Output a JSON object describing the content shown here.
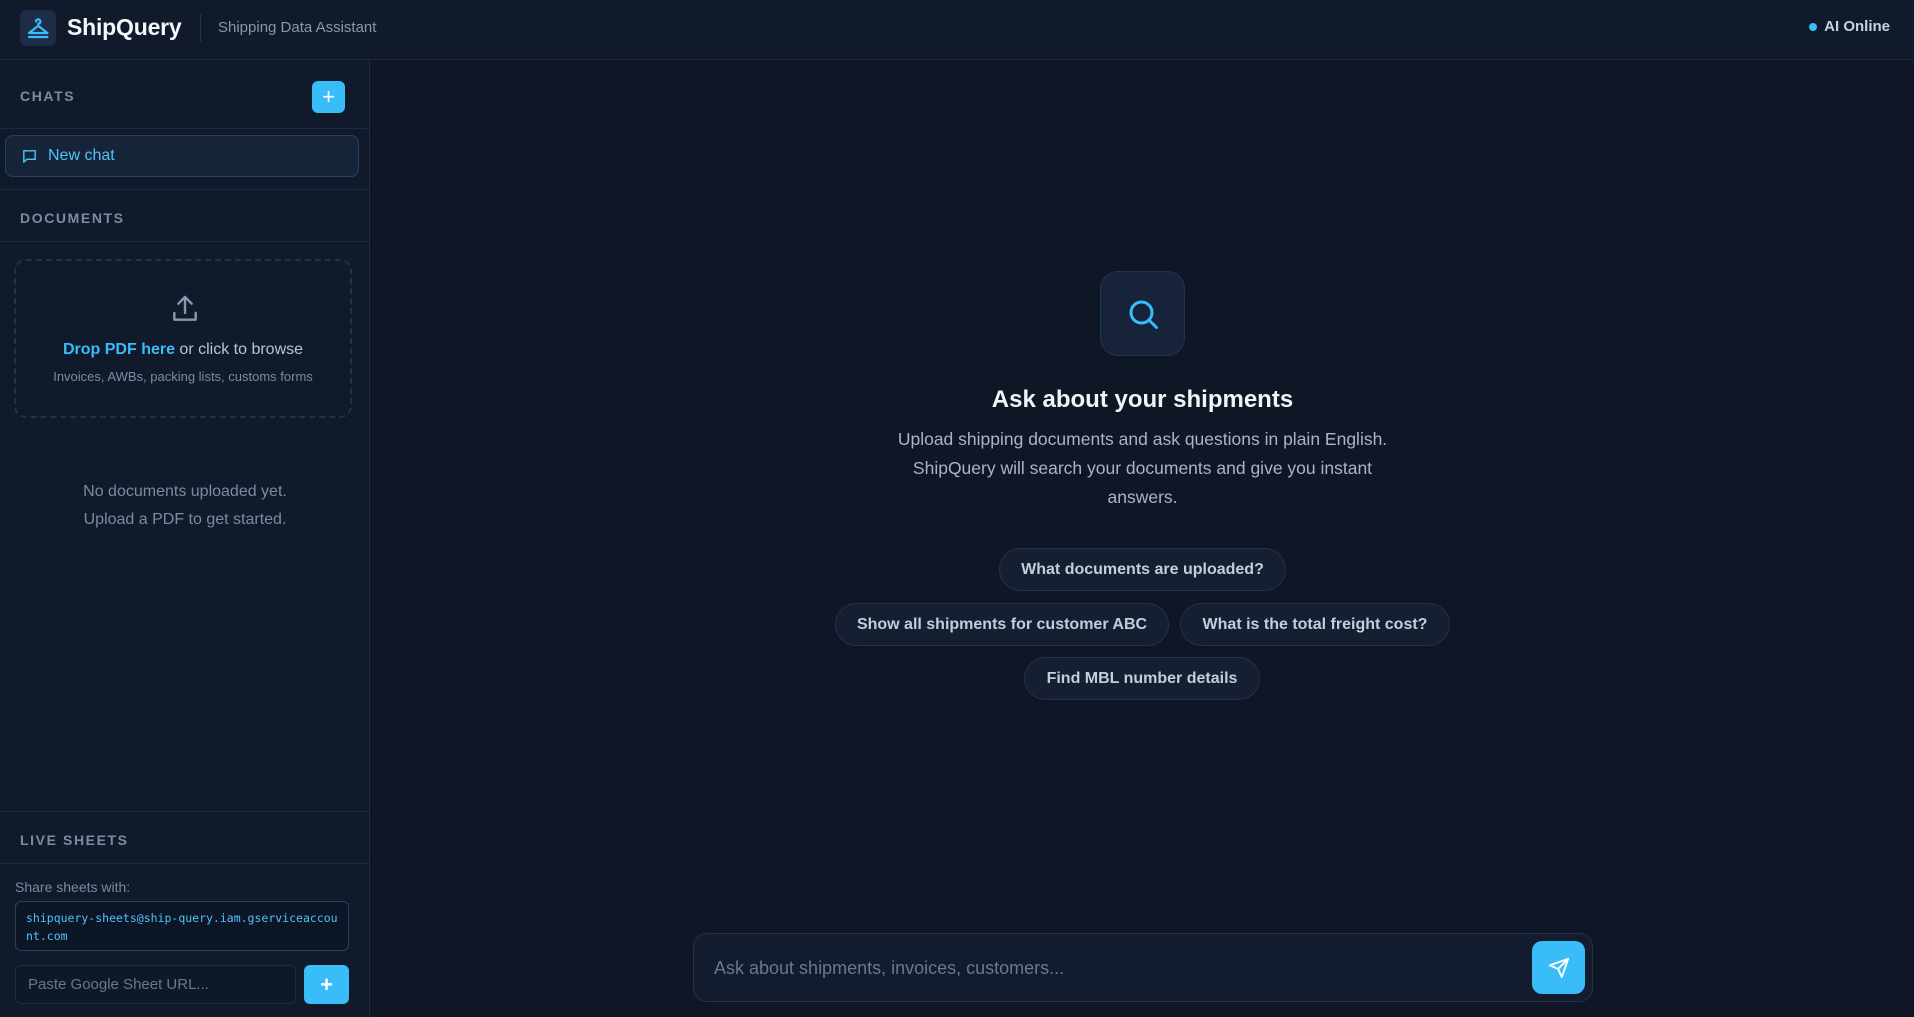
{
  "header": {
    "brand": "ShipQuery",
    "subtitle": "Shipping Data Assistant",
    "status": "AI Online",
    "logo_icon": "hanger-icon"
  },
  "sidebar": {
    "chats": {
      "title": "CHATS",
      "new_button": "+",
      "items": [
        {
          "label": "New chat",
          "icon": "message-icon"
        }
      ]
    },
    "documents": {
      "title": "DOCUMENTS",
      "drop_highlight": "Drop PDF here",
      "drop_rest": " or click to browse",
      "drop_hint": "Invoices, AWBs, packing lists, customs forms",
      "empty_line1": "No documents uploaded yet.",
      "empty_line2": "Upload a PDF to get started."
    },
    "live_sheets": {
      "title": "LIVE SHEETS",
      "share_label": "Share sheets with:",
      "share_email": "shipquery-sheets@ship-query.iam.gserviceaccount.com",
      "url_placeholder": "Paste Google Sheet URL...",
      "add_button": "+"
    }
  },
  "main": {
    "hero_icon": "search-icon",
    "title": "Ask about your shipments",
    "description": "Upload shipping documents and ask questions in plain English. ShipQuery will search your documents and give you instant answers.",
    "suggestions": [
      "What documents are uploaded?",
      "Show all shipments for customer ABC",
      "What is the total freight cost?",
      "Find MBL number details"
    ],
    "composer": {
      "placeholder": "Ask about shipments, invoices, customers...",
      "send_icon": "send-icon"
    }
  },
  "colors": {
    "accent": "#38bdf8",
    "background": "#0f1625",
    "panel": "#111a2b"
  }
}
